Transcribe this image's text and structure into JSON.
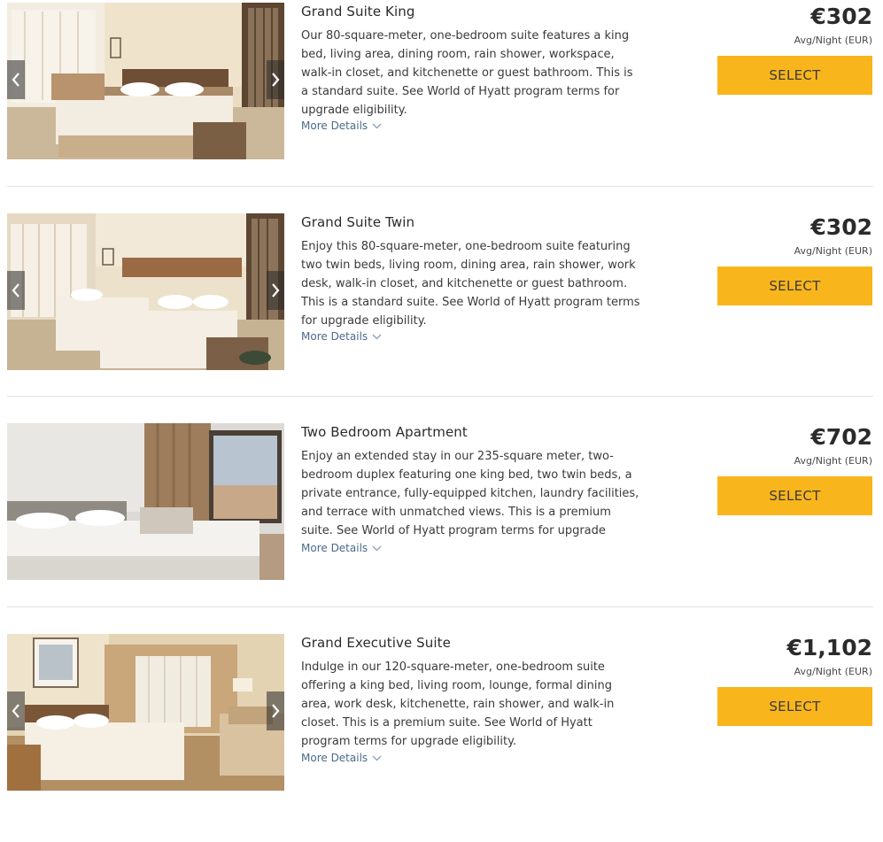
{
  "rooms": [
    {
      "name": "Grand Suite King",
      "description": "Our 80-square-meter, one-bedroom suite features a king bed, living area, dining room, rain shower, workspace, walk-in closet, and kitchenette or guest bathroom. This is a standard suite. See World of Hyatt program terms for upgrade eligibility.",
      "more_details": "More Details",
      "price": "€302",
      "price_note": "Avg/Night (EUR)",
      "select_label": "SELECT"
    },
    {
      "name": "Grand Suite Twin",
      "description": "Enjoy this 80-square-meter, one-bedroom suite featuring two twin beds, living room, dining area, rain shower, work desk, walk-in closet, and kitchenette or guest bathroom. This is a standard suite. See World of Hyatt program terms for upgrade eligibility.",
      "more_details": "More Details",
      "price": "€302",
      "price_note": "Avg/Night (EUR)",
      "select_label": "SELECT"
    },
    {
      "name": "Two Bedroom Apartment",
      "description": "Enjoy an extended stay in our 235-square meter, two-bedroom duplex featuring one king bed, two twin beds, a private entrance, fully-equipped kitchen, laundry facilities, and terrace with unmatched views. This is a premium suite. See World of Hyatt program terms for upgrade eligibility.",
      "more_details": "More Details",
      "price": "€702",
      "price_note": "Avg/Night (EUR)",
      "select_label": "SELECT"
    },
    {
      "name": "Grand Executive Suite",
      "description": "Indulge in our 120-square-meter, one-bedroom suite offering a king bed, living room, lounge, formal dining area, work desk, kitchenette, rain shower, and walk-in closet. This is a premium suite. See World of Hyatt program terms for upgrade eligibility.",
      "more_details": "More Details",
      "price": "€1,102",
      "price_note": "Avg/Night (EUR)",
      "select_label": "SELECT"
    }
  ],
  "colors": {
    "select_button": "#f9b51c",
    "link": "#4a6a8a",
    "divider": "#e2e2e2"
  }
}
